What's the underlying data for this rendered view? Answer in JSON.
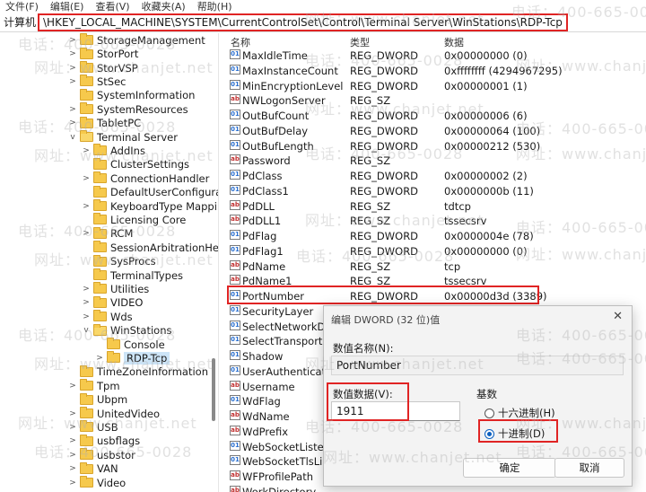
{
  "menu": [
    "文件(F)",
    "编辑(E)",
    "查看(V)",
    "收藏夹(A)",
    "帮助(H)"
  ],
  "address": {
    "prefix": "计算机",
    "path": "\\HKEY_LOCAL_MACHINE\\SYSTEM\\CurrentControlSet\\Control\\Terminal Server\\WinStations\\RDP-Tcp"
  },
  "tree": [
    {
      "label": "StorageManagement",
      "level": 0,
      "chev": ">"
    },
    {
      "label": "StorPort",
      "level": 0,
      "chev": ">"
    },
    {
      "label": "StorVSP",
      "level": 0,
      "chev": ">"
    },
    {
      "label": "StSec",
      "level": 0,
      "chev": ">"
    },
    {
      "label": "SystemInformation",
      "level": 0,
      "chev": ""
    },
    {
      "label": "SystemResources",
      "level": 0,
      "chev": ">"
    },
    {
      "label": "TabletPC",
      "level": 0,
      "chev": ">"
    },
    {
      "label": "Terminal Server",
      "level": 0,
      "chev": "v"
    },
    {
      "label": "AddIns",
      "level": 1,
      "chev": ">"
    },
    {
      "label": "ClusterSettings",
      "level": 1,
      "chev": ""
    },
    {
      "label": "ConnectionHandler",
      "level": 1,
      "chev": ">"
    },
    {
      "label": "DefaultUserConfigurat",
      "level": 1,
      "chev": ""
    },
    {
      "label": "KeyboardType Mappi",
      "level": 1,
      "chev": ">"
    },
    {
      "label": "Licensing Core",
      "level": 1,
      "chev": ""
    },
    {
      "label": "RCM",
      "level": 1,
      "chev": ">"
    },
    {
      "label": "SessionArbitrationHel",
      "level": 1,
      "chev": ""
    },
    {
      "label": "SysProcs",
      "level": 1,
      "chev": ""
    },
    {
      "label": "TerminalTypes",
      "level": 1,
      "chev": ""
    },
    {
      "label": "Utilities",
      "level": 1,
      "chev": ">"
    },
    {
      "label": "VIDEO",
      "level": 1,
      "chev": ">"
    },
    {
      "label": "Wds",
      "level": 1,
      "chev": ">"
    },
    {
      "label": "WinStations",
      "level": 1,
      "chev": "v"
    },
    {
      "label": "Console",
      "level": 2,
      "chev": ""
    },
    {
      "label": "RDP-Tcp",
      "level": 2,
      "chev": ">",
      "selected": true
    },
    {
      "label": "TimeZoneInformation",
      "level": 0,
      "chev": ""
    },
    {
      "label": "Tpm",
      "level": 0,
      "chev": ">"
    },
    {
      "label": "Ubpm",
      "level": 0,
      "chev": ""
    },
    {
      "label": "UnitedVideo",
      "level": 0,
      "chev": ">"
    },
    {
      "label": "USB",
      "level": 0,
      "chev": ">"
    },
    {
      "label": "usbflags",
      "level": 0,
      "chev": ">"
    },
    {
      "label": "usbstor",
      "level": 0,
      "chev": ">"
    },
    {
      "label": "VAN",
      "level": 0,
      "chev": ">"
    },
    {
      "label": "Video",
      "level": 0,
      "chev": ">"
    }
  ],
  "columns": {
    "name": "名称",
    "type": "类型",
    "data": "数据"
  },
  "values": [
    {
      "name": "MaxIdleTime",
      "type": "REG_DWORD",
      "data": "0x00000000 (0)",
      "kind": "bin"
    },
    {
      "name": "MaxInstanceCount",
      "type": "REG_DWORD",
      "data": "0xffffffff (4294967295)",
      "kind": "bin"
    },
    {
      "name": "MinEncryptionLevel",
      "type": "REG_DWORD",
      "data": "0x00000001 (1)",
      "kind": "bin"
    },
    {
      "name": "NWLogonServer",
      "type": "REG_SZ",
      "data": "",
      "kind": "str"
    },
    {
      "name": "OutBufCount",
      "type": "REG_DWORD",
      "data": "0x00000006 (6)",
      "kind": "bin"
    },
    {
      "name": "OutBufDelay",
      "type": "REG_DWORD",
      "data": "0x00000064 (100)",
      "kind": "bin"
    },
    {
      "name": "OutBufLength",
      "type": "REG_DWORD",
      "data": "0x00000212 (530)",
      "kind": "bin"
    },
    {
      "name": "Password",
      "type": "REG_SZ",
      "data": "",
      "kind": "str"
    },
    {
      "name": "PdClass",
      "type": "REG_DWORD",
      "data": "0x00000002 (2)",
      "kind": "bin"
    },
    {
      "name": "PdClass1",
      "type": "REG_DWORD",
      "data": "0x0000000b (11)",
      "kind": "bin"
    },
    {
      "name": "PdDLL",
      "type": "REG_SZ",
      "data": "tdtcp",
      "kind": "str"
    },
    {
      "name": "PdDLL1",
      "type": "REG_SZ",
      "data": "tssecsrv",
      "kind": "str"
    },
    {
      "name": "PdFlag",
      "type": "REG_DWORD",
      "data": "0x0000004e (78)",
      "kind": "bin"
    },
    {
      "name": "PdFlag1",
      "type": "REG_DWORD",
      "data": "0x00000000 (0)",
      "kind": "bin"
    },
    {
      "name": "PdName",
      "type": "REG_SZ",
      "data": "tcp",
      "kind": "str"
    },
    {
      "name": "PdName1",
      "type": "REG_SZ",
      "data": "tssecsrv",
      "kind": "str"
    },
    {
      "name": "PortNumber",
      "type": "REG_DWORD",
      "data": "0x00000d3d (3389)",
      "kind": "bin"
    },
    {
      "name": "SecurityLayer",
      "type": "",
      "data": "",
      "kind": "bin"
    },
    {
      "name": "SelectNetworkDe",
      "type": "",
      "data": "",
      "kind": "bin"
    },
    {
      "name": "SelectTransport",
      "type": "",
      "data": "",
      "kind": "bin"
    },
    {
      "name": "Shadow",
      "type": "",
      "data": "",
      "kind": "bin"
    },
    {
      "name": "UserAuthenticati",
      "type": "",
      "data": "",
      "kind": "bin"
    },
    {
      "name": "Username",
      "type": "",
      "data": "",
      "kind": "str"
    },
    {
      "name": "WdFlag",
      "type": "",
      "data": "",
      "kind": "bin"
    },
    {
      "name": "WdName",
      "type": "",
      "data": "",
      "kind": "str"
    },
    {
      "name": "WdPrefix",
      "type": "",
      "data": "",
      "kind": "str"
    },
    {
      "name": "WebSocketListen",
      "type": "",
      "data": "",
      "kind": "bin"
    },
    {
      "name": "WebSocketTlsList",
      "type": "",
      "data": "",
      "kind": "bin"
    },
    {
      "name": "WFProfilePath",
      "type": "",
      "data": "",
      "kind": "str"
    },
    {
      "name": "WorkDirectory",
      "type": "",
      "data": "",
      "kind": "str"
    }
  ],
  "dialog": {
    "title": "编辑 DWORD (32 位)值",
    "close": "✕",
    "name_label": "数值名称(N):",
    "name_value": "PortNumber",
    "data_label": "数值数据(V):",
    "data_value": "1911",
    "base_label": "基数",
    "radio_hex": "十六进制(H)",
    "radio_dec": "十进制(D)",
    "selected_base": "decimal",
    "ok": "确定",
    "cancel": "取消"
  },
  "watermark": {
    "phone": "电话：400-665-0028",
    "site": "网址：www.chanjet.net"
  },
  "colors": {
    "highlight": "#e02424",
    "selection": "#cce4f7",
    "folder": "#f6c94c"
  }
}
